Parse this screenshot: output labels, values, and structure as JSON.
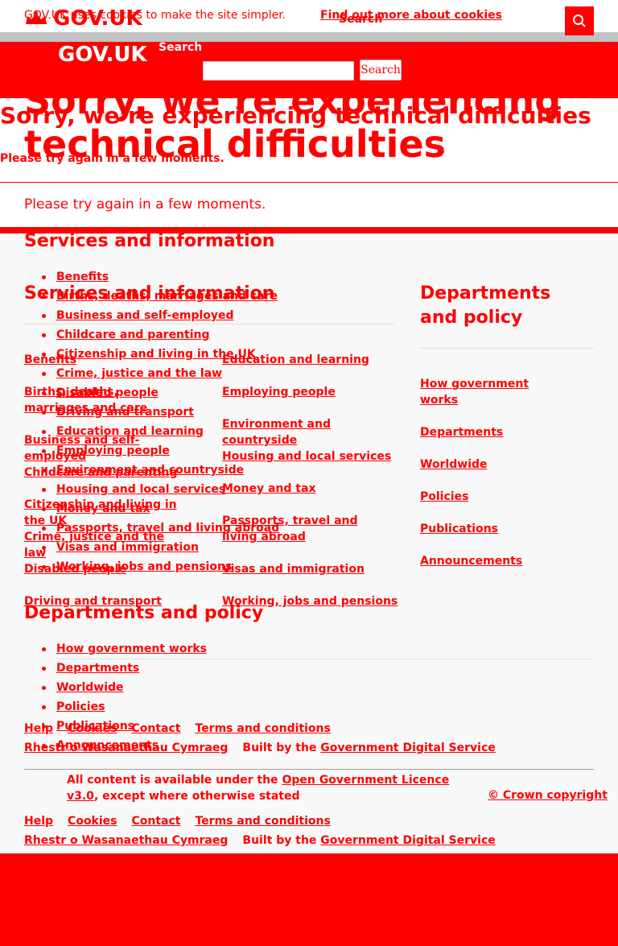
{
  "cookie_banner": {
    "text": "GOV.UK uses cookies to make the site simpler.",
    "link": "Find out more about cookies"
  },
  "header": {
    "logo_text": "GOV.UK",
    "search_label": "Search",
    "search_placeholder": "Search",
    "search_button": "Search"
  },
  "main": {
    "title": "Sorry, we’re experiencing technical difficulties",
    "lead": "Please try again in a few moments."
  },
  "footer": {
    "services_heading": "Services and information",
    "departments_heading": "Departments and policy",
    "services_col1": [
      "Benefits",
      "Births, deaths, marriages and care",
      "Business and self-employed",
      "Childcare and parenting",
      "Citizenship and living in the UK",
      "Crime, justice and the law",
      "Disabled people",
      "Driving and transport"
    ],
    "services_col2": [
      "Education and learning",
      "Employing people",
      "Environment and countryside",
      "Housing and local services",
      "Money and tax",
      "Passports, travel and living abroad",
      "Visas and immigration",
      "Working, jobs and pensions"
    ],
    "services_all": [
      "Benefits",
      "Births, deaths, marriages and care",
      "Business and self-employed",
      "Childcare and parenting",
      "Citizenship and living in the UK",
      "Crime, justice and the law",
      "Disabled people",
      "Driving and transport",
      "Education and learning",
      "Employing people",
      "Environment and countryside",
      "Housing and local services",
      "Money and tax",
      "Passports, travel and living abroad",
      "Visas and immigration",
      "Working, jobs and pensions"
    ],
    "departments": [
      "How government works",
      "Departments",
      "Worldwide",
      "Policies",
      "Publications",
      "Announcements"
    ],
    "meta_links": [
      "Help",
      "Cookies",
      "Contact",
      "Terms and conditions"
    ],
    "welsh_link": "Rhestr o Wasanaethau Cymraeg",
    "built_by_prefix": "Built by the",
    "built_by_link": "Government Digital Service",
    "licence_prefix": "All content is available under the",
    "licence_link": "Open Government Licence v3.0",
    "licence_suffix": ", except where otherwise stated",
    "copyright": "© Crown copyright"
  }
}
